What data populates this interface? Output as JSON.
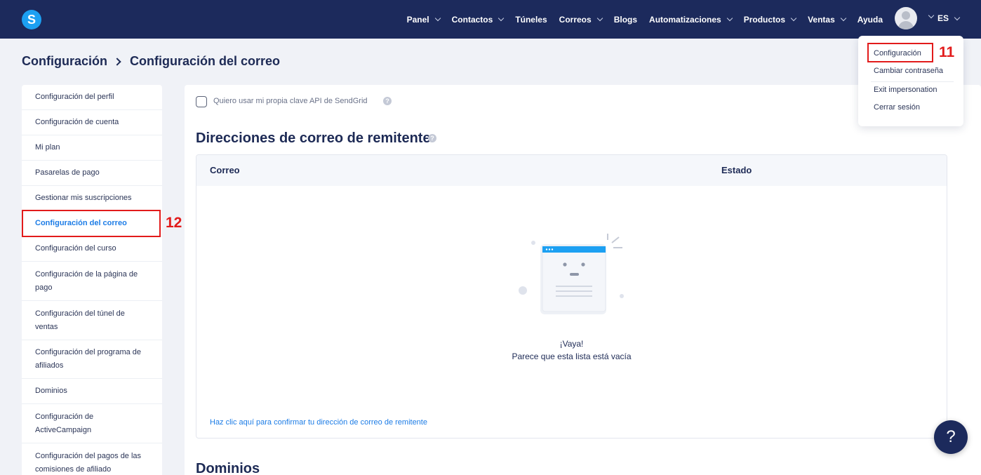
{
  "brand": {
    "logo_letter": "S",
    "accent": "#1ca0f2",
    "topbar_bg": "#1c2a5c"
  },
  "nav": {
    "items": [
      {
        "label": "Panel",
        "has_dropdown": true
      },
      {
        "label": "Contactos",
        "has_dropdown": true
      },
      {
        "label": "Túneles",
        "has_dropdown": false
      },
      {
        "label": "Correos",
        "has_dropdown": true
      },
      {
        "label": "Blogs",
        "has_dropdown": false
      },
      {
        "label": "Automatizaciones",
        "has_dropdown": true
      },
      {
        "label": "Productos",
        "has_dropdown": true
      },
      {
        "label": "Ventas",
        "has_dropdown": true
      },
      {
        "label": "Ayuda",
        "has_dropdown": false
      }
    ],
    "language": "ES"
  },
  "user_menu": {
    "items": [
      "Configuración",
      "Cambiar contraseña",
      "Exit impersonation",
      "Cerrar sesión"
    ]
  },
  "annotations": {
    "menu_marker": "11",
    "sidebar_marker": "12",
    "color": "#e21b1b"
  },
  "breadcrumb": {
    "parent": "Configuración",
    "current": "Configuración del correo"
  },
  "sidebar": {
    "items": [
      "Configuración del perfil",
      "Configuración de cuenta",
      "Mi plan",
      "Pasarelas de pago",
      "Gestionar mis suscripciones",
      "Configuración del correo",
      "Configuración del curso",
      "Configuración de la página de pago",
      "Configuración del túnel de ventas",
      "Configuración del programa de afiliados",
      "Dominios",
      "Configuración de ActiveCampaign",
      "Configuración del pagos de las comisiones de afiliado"
    ],
    "active_index": 5
  },
  "main": {
    "sendgrid_checkbox_label": "Quiero usar mi propia clave API de SendGrid",
    "sendgrid_checked": false,
    "sender_section_title": "Direcciones de correo de remitente",
    "table": {
      "columns": [
        "Correo",
        "Estado"
      ],
      "rows": [],
      "empty_title": "¡Vaya!",
      "empty_message": "Parece que esta lista está vacía"
    },
    "confirm_link": "Haz clic aquí para confirmar tu dirección de correo de remitente",
    "domains_section_title": "Dominios"
  },
  "help_button": "?"
}
